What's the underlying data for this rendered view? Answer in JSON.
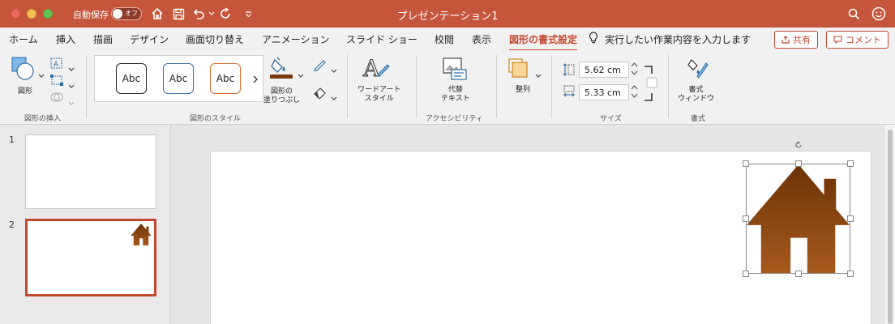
{
  "titlebar": {
    "autosave_label": "自動保存",
    "autosave_state": "オフ",
    "window_title": "プレゼンテーション1"
  },
  "tabs": [
    {
      "label": "ホーム"
    },
    {
      "label": "挿入"
    },
    {
      "label": "描画"
    },
    {
      "label": "デザイン"
    },
    {
      "label": "画面切り替え"
    },
    {
      "label": "アニメーション"
    },
    {
      "label": "スライド ショー"
    },
    {
      "label": "校閲"
    },
    {
      "label": "表示"
    },
    {
      "label": "図形の書式設定"
    }
  ],
  "active_tab_index": 9,
  "tell_me": "実行したい作業内容を入力します",
  "share_label": "共有",
  "comment_label": "コメント",
  "ribbon": {
    "shape_label": "図形",
    "insert_group_label": "図形の挿入",
    "style_samples": [
      {
        "text": "Abc",
        "border_color": "#222222"
      },
      {
        "text": "Abc",
        "border_color": "#3a6ea5"
      },
      {
        "text": "Abc",
        "border_color": "#d06c2a"
      }
    ],
    "fill_label": "図形の\n塗りつぶし",
    "styles_group_label": "図形のスタイル",
    "wordart_label": "ワードアート\nスタイル",
    "alt_text_label": "代替\nテキスト",
    "accessibility_group_label": "アクセシビリティ",
    "arrange_label": "整列",
    "height_value": "5.62 cm",
    "width_value": "5.33 cm",
    "size_group_label": "サイズ",
    "format_pane_label": "書式\nウィンドウ",
    "format_group_label": "書式"
  },
  "slides": [
    {
      "number": "1"
    },
    {
      "number": "2"
    }
  ],
  "selected_slide_index": 1,
  "colors": {
    "accent": "#c4482e",
    "titlebar": "#c5553b",
    "house_fill_top": "#6b3206",
    "house_fill_bottom": "#a65a1e"
  }
}
